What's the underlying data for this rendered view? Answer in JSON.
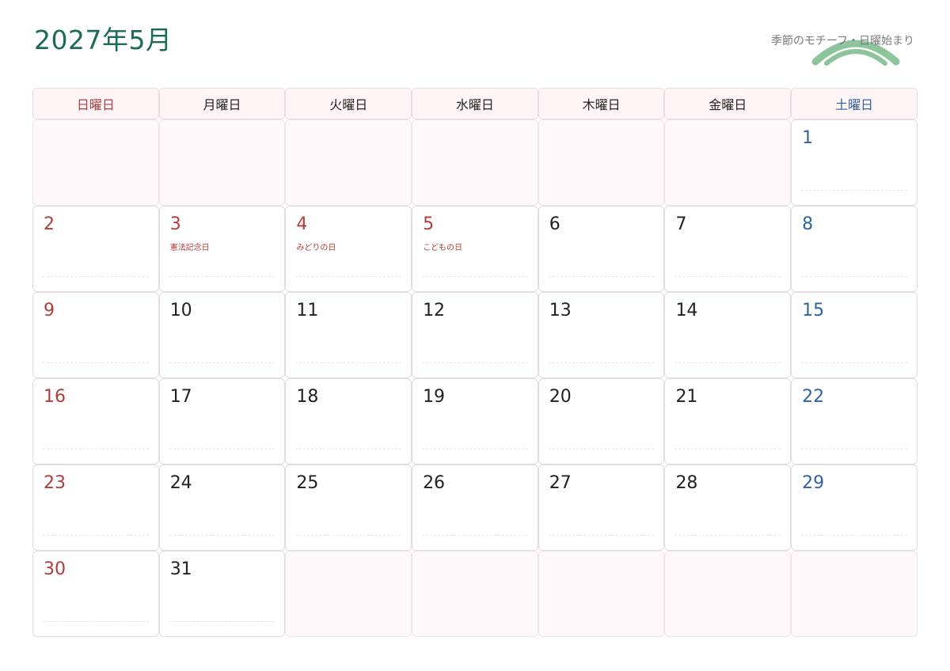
{
  "title": "2027年5月",
  "subtitle": "季節のモチーフ・日曜始まり",
  "weekdays": [
    "日曜日",
    "月曜日",
    "火曜日",
    "水曜日",
    "木曜日",
    "金曜日",
    "土曜日"
  ],
  "colors": {
    "title": "#1d6b56",
    "sunday": "#b23b3b",
    "saturday": "#2f63a8",
    "holiday": "#b23b3b",
    "motif": "#8cc49b"
  },
  "days": [
    {
      "cell": 6,
      "day": "1",
      "kind": "sat"
    },
    {
      "cell": 7,
      "day": "2",
      "kind": "sun"
    },
    {
      "cell": 8,
      "day": "3",
      "kind": "hol",
      "holiday": "憲法記念日"
    },
    {
      "cell": 9,
      "day": "4",
      "kind": "hol",
      "holiday": "みどりの日"
    },
    {
      "cell": 10,
      "day": "5",
      "kind": "hol",
      "holiday": "こどもの日"
    },
    {
      "cell": 11,
      "day": "6",
      "kind": "normal"
    },
    {
      "cell": 12,
      "day": "7",
      "kind": "normal"
    },
    {
      "cell": 13,
      "day": "8",
      "kind": "sat"
    },
    {
      "cell": 14,
      "day": "9",
      "kind": "sun"
    },
    {
      "cell": 15,
      "day": "10",
      "kind": "normal"
    },
    {
      "cell": 16,
      "day": "11",
      "kind": "normal"
    },
    {
      "cell": 17,
      "day": "12",
      "kind": "normal"
    },
    {
      "cell": 18,
      "day": "13",
      "kind": "normal"
    },
    {
      "cell": 19,
      "day": "14",
      "kind": "normal"
    },
    {
      "cell": 20,
      "day": "15",
      "kind": "sat"
    },
    {
      "cell": 21,
      "day": "16",
      "kind": "sun"
    },
    {
      "cell": 22,
      "day": "17",
      "kind": "normal"
    },
    {
      "cell": 23,
      "day": "18",
      "kind": "normal"
    },
    {
      "cell": 24,
      "day": "19",
      "kind": "normal"
    },
    {
      "cell": 25,
      "day": "20",
      "kind": "normal"
    },
    {
      "cell": 26,
      "day": "21",
      "kind": "normal"
    },
    {
      "cell": 27,
      "day": "22",
      "kind": "sat"
    },
    {
      "cell": 28,
      "day": "23",
      "kind": "sun"
    },
    {
      "cell": 29,
      "day": "24",
      "kind": "normal"
    },
    {
      "cell": 30,
      "day": "25",
      "kind": "normal"
    },
    {
      "cell": 31,
      "day": "26",
      "kind": "normal"
    },
    {
      "cell": 32,
      "day": "27",
      "kind": "normal"
    },
    {
      "cell": 33,
      "day": "28",
      "kind": "normal"
    },
    {
      "cell": 34,
      "day": "29",
      "kind": "sat"
    },
    {
      "cell": 35,
      "day": "30",
      "kind": "sun"
    },
    {
      "cell": 36,
      "day": "31",
      "kind": "normal"
    }
  ]
}
